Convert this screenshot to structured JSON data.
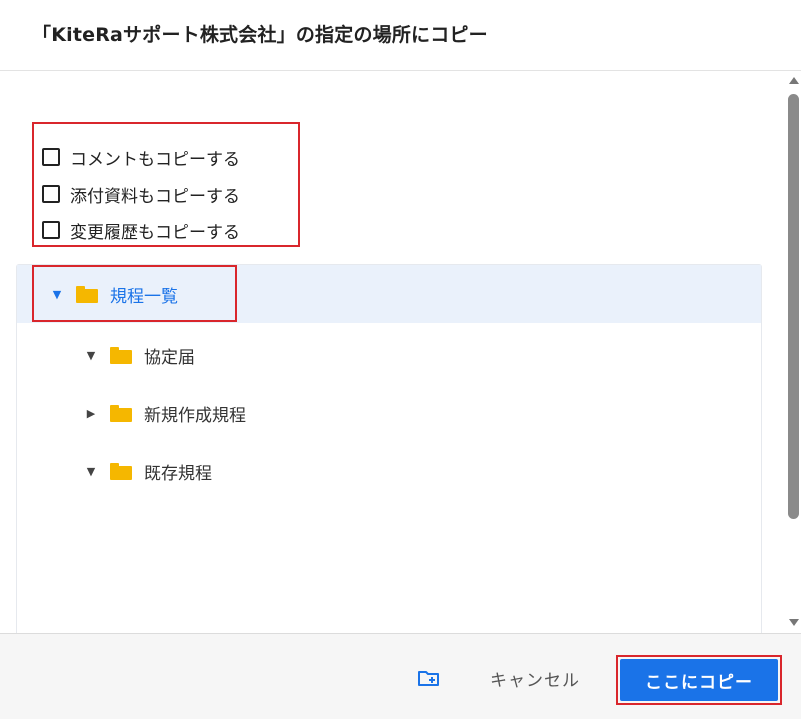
{
  "dialog": {
    "title": "「KiteRaサポート株式会社」の指定の場所にコピー"
  },
  "options": [
    {
      "label": "コメントもコピーする",
      "checked": false
    },
    {
      "label": "添付資料もコピーする",
      "checked": false
    },
    {
      "label": "変更履歴もコピーする",
      "checked": false
    }
  ],
  "tree": {
    "root": {
      "name": "規程一覧",
      "expanded": true,
      "selected": true
    },
    "children": [
      {
        "name": "協定届",
        "expanded": true
      },
      {
        "name": "新規作成規程",
        "expanded": false
      },
      {
        "name": "既存規程",
        "expanded": true
      }
    ]
  },
  "footer": {
    "new_folder_icon": "new-folder-icon",
    "cancel_label": "キャンセル",
    "copy_label": "ここにコピー"
  },
  "colors": {
    "accent": "#1a73e8",
    "folder": "#f5b700",
    "highlight": "#d9262c",
    "selected_bg": "#eaf1fb"
  }
}
